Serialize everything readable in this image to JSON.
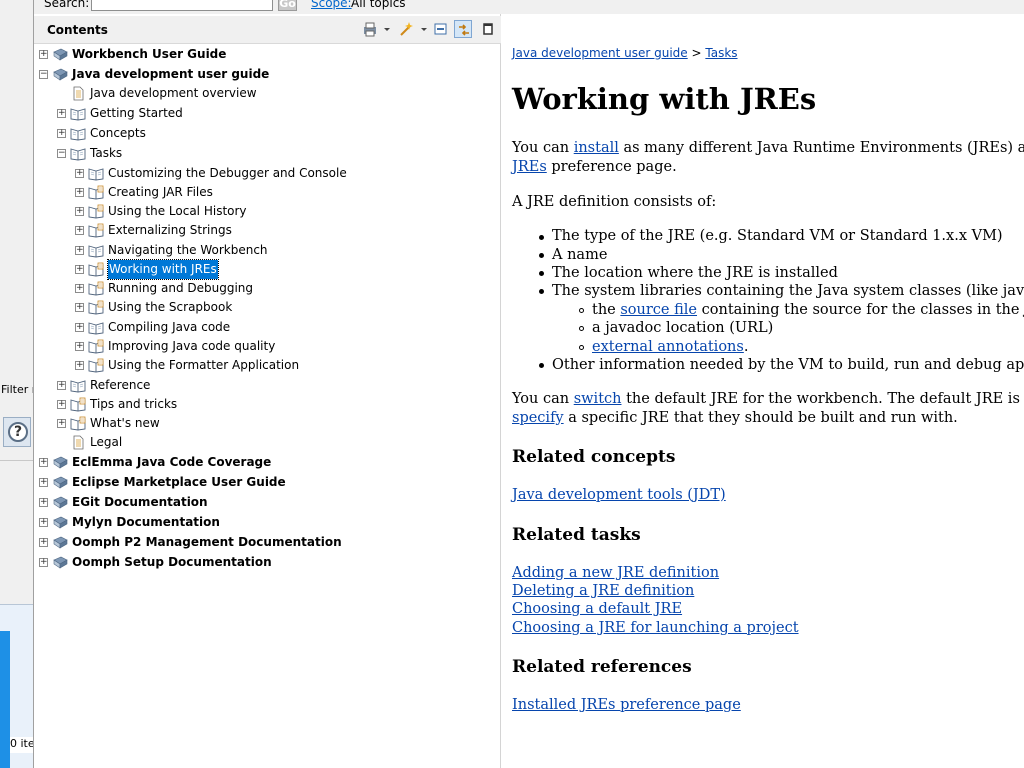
{
  "search": {
    "label": "Search:",
    "go_label": "Go",
    "scope_label": "Scope:",
    "scope_value": "All topics"
  },
  "left_strip": {
    "filter_label": "Filter n",
    "items_label": "0 ite"
  },
  "contents": {
    "title": "Contents",
    "tree": [
      {
        "label": "Workbench User Guide",
        "bold": true,
        "expander": "+",
        "icon": "book-icon",
        "level": 0
      },
      {
        "label": "Java development user guide",
        "bold": true,
        "expander": "-",
        "icon": "book-icon",
        "level": 0
      },
      {
        "label": "Java development overview",
        "bold": false,
        "expander": "",
        "icon": "page-icon",
        "level": 1
      },
      {
        "label": "Getting Started",
        "bold": false,
        "expander": "+",
        "icon": "open-book-icon",
        "level": 1
      },
      {
        "label": "Concepts",
        "bold": false,
        "expander": "+",
        "icon": "open-book-icon",
        "level": 1
      },
      {
        "label": "Tasks",
        "bold": false,
        "expander": "-",
        "icon": "open-book-icon",
        "level": 1
      },
      {
        "label": "Customizing the Debugger and Console",
        "bold": false,
        "expander": "+",
        "icon": "open-book-icon",
        "level": 2
      },
      {
        "label": "Creating JAR Files",
        "bold": false,
        "expander": "+",
        "icon": "open-book-page-icon",
        "level": 2
      },
      {
        "label": "Using the Local History",
        "bold": false,
        "expander": "+",
        "icon": "open-book-page-icon",
        "level": 2
      },
      {
        "label": "Externalizing Strings",
        "bold": false,
        "expander": "+",
        "icon": "open-book-page-icon",
        "level": 2
      },
      {
        "label": "Navigating the Workbench",
        "bold": false,
        "expander": "+",
        "icon": "open-book-icon",
        "level": 2
      },
      {
        "label": "Working with JREs",
        "bold": false,
        "expander": "+",
        "icon": "open-book-page-icon",
        "level": 2,
        "selected": true
      },
      {
        "label": "Running and Debugging",
        "bold": false,
        "expander": "+",
        "icon": "open-book-page-icon",
        "level": 2
      },
      {
        "label": "Using the Scrapbook",
        "bold": false,
        "expander": "+",
        "icon": "open-book-page-icon",
        "level": 2
      },
      {
        "label": "Compiling Java code",
        "bold": false,
        "expander": "+",
        "icon": "open-book-icon",
        "level": 2
      },
      {
        "label": "Improving Java code quality",
        "bold": false,
        "expander": "+",
        "icon": "open-book-page-icon",
        "level": 2
      },
      {
        "label": "Using the Formatter Application",
        "bold": false,
        "expander": "+",
        "icon": "open-book-page-icon",
        "level": 2
      },
      {
        "label": "Reference",
        "bold": false,
        "expander": "+",
        "icon": "open-book-icon",
        "level": 1
      },
      {
        "label": "Tips and tricks",
        "bold": false,
        "expander": "+",
        "icon": "open-book-page-icon",
        "level": 1
      },
      {
        "label": "What's new",
        "bold": false,
        "expander": "+",
        "icon": "open-book-page-icon",
        "level": 1
      },
      {
        "label": "Legal",
        "bold": false,
        "expander": "",
        "icon": "page-icon",
        "level": 1
      },
      {
        "label": "EclEmma Java Code Coverage",
        "bold": true,
        "expander": "+",
        "icon": "book-icon",
        "level": 0
      },
      {
        "label": "Eclipse Marketplace User Guide",
        "bold": true,
        "expander": "+",
        "icon": "book-icon",
        "level": 0
      },
      {
        "label": "EGit Documentation",
        "bold": true,
        "expander": "+",
        "icon": "book-icon",
        "level": 0
      },
      {
        "label": "Mylyn Documentation",
        "bold": true,
        "expander": "+",
        "icon": "book-icon",
        "level": 0
      },
      {
        "label": "Oomph P2 Management Documentation",
        "bold": true,
        "expander": "+",
        "icon": "book-icon",
        "level": 0
      },
      {
        "label": "Oomph Setup Documentation",
        "bold": true,
        "expander": "+",
        "icon": "book-icon",
        "level": 0
      }
    ]
  },
  "doc": {
    "breadcrumb": {
      "part1": "Java development user guide",
      "sep": " > ",
      "part2": "Tasks"
    },
    "title": "Working with JREs",
    "p1": {
      "pre": "You can ",
      "link": "install",
      "post": " as many different Java Runtime Environments (JREs) as you lik"
    },
    "p1b": {
      "link": "JREs",
      "post": " preference page."
    },
    "p2": "A JRE definition consists of:",
    "bullets": [
      "The type of the JRE (e.g. Standard VM or Standard 1.x.x VM)",
      "A name",
      "The location where the JRE is installed",
      "The system libraries containing the Java system classes (like java.lang.Ob"
    ],
    "sub_bullets": {
      "s1_pre": "the ",
      "s1_link": "source file",
      "s1_post": " containing the source for the classes in the JRE's CL",
      "s2": "a javadoc location (URL)",
      "s3_link": "external annotations",
      "s3_post": "."
    },
    "bullet5": "Other information needed by the VM to build, run and debug applications",
    "p3": {
      "pre": "You can ",
      "link": "switch",
      "post": " the default JRE for the workbench. The default JRE is used by c"
    },
    "p3b": {
      "link": "specify",
      "post": " a specific JRE that they should be built and run with."
    },
    "related_concepts_h": "Related concepts",
    "related_concepts": [
      "Java development tools (JDT)"
    ],
    "related_tasks_h": "Related tasks",
    "related_tasks": [
      "Adding a new JRE definition",
      "Deleting a JRE definition",
      "Choosing a default JRE",
      "Choosing a JRE for launching a project"
    ],
    "related_refs_h": "Related references",
    "related_refs": [
      "Installed JREs preference page"
    ]
  }
}
